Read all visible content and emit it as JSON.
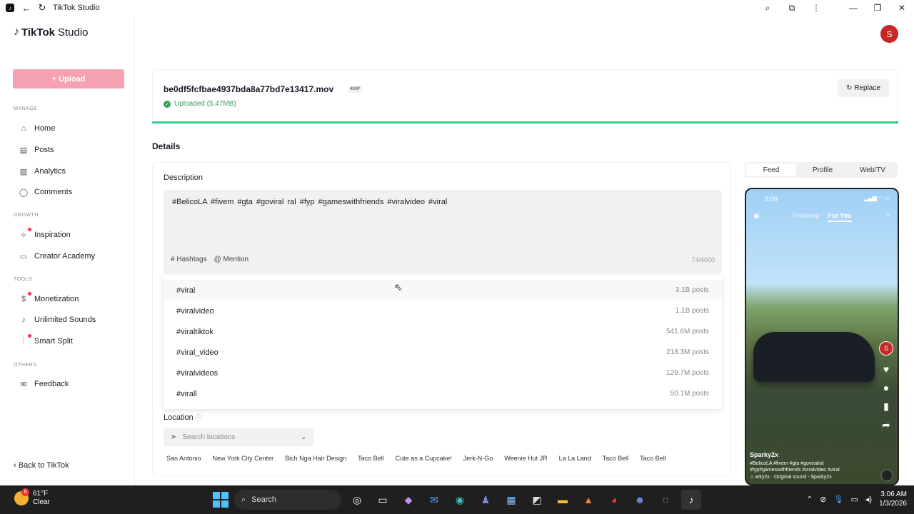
{
  "window": {
    "title": "TikTok Studio"
  },
  "brand": {
    "name": "TikTok",
    "suffix": "Studio"
  },
  "sidebar": {
    "upload_label": "+ Upload",
    "sections": [
      {
        "title": "MANAGE",
        "items": [
          {
            "label": "Home",
            "icon": "home-icon"
          },
          {
            "label": "Posts",
            "icon": "posts-icon"
          },
          {
            "label": "Analytics",
            "icon": "analytics-icon"
          },
          {
            "label": "Comments",
            "icon": "comments-icon"
          }
        ]
      },
      {
        "title": "GROWTH",
        "items": [
          {
            "label": "Inspiration",
            "icon": "bulb-icon"
          },
          {
            "label": "Creator Academy",
            "icon": "academy-icon"
          }
        ]
      },
      {
        "title": "TOOLS",
        "items": [
          {
            "label": "Monetization",
            "icon": "money-icon"
          },
          {
            "label": "Unlimited Sounds",
            "icon": "music-icon"
          },
          {
            "label": "Smart Split",
            "icon": "split-icon"
          }
        ]
      },
      {
        "title": "OTHERS",
        "items": [
          {
            "label": "Feedback",
            "icon": "feedback-icon"
          }
        ]
      }
    ],
    "back_label": "Back to TikTok"
  },
  "header": {
    "avatar_initial": "S"
  },
  "file": {
    "name": "be0df5fcfbae4937bda8a77bd7e13417.mov",
    "resolution": "480P",
    "status": "Uploaded",
    "size": "(5.47MB)",
    "replace_label": "Replace",
    "progress": 1.0
  },
  "details": {
    "title": "Details",
    "description_label": "Description",
    "description_text": "#BelicoLA  #fivem  #gta  #goviral ral  #fyp #gameswithfriends  #viralvideo  #viral",
    "hashtags_label": "Hashtags",
    "mention_label": "@ Mention",
    "char_count": "74/4000",
    "suggestions": [
      {
        "tag": "#viral",
        "count": "3.1B posts"
      },
      {
        "tag": "#viralvideo",
        "count": "1.1B posts"
      },
      {
        "tag": "#viraltiktok",
        "count": "541.6M posts"
      },
      {
        "tag": "#viral_video",
        "count": "218.3M posts"
      },
      {
        "tag": "#viralvideos",
        "count": "129.7M posts"
      },
      {
        "tag": "#virall",
        "count": "50.1M posts"
      }
    ],
    "location_label": "Location",
    "location_placeholder": "Search locations",
    "location_chips": [
      "San Antonio",
      "New York City Center",
      "Bich Nga Hair Design",
      "Taco Bell",
      "Cute as a Cupcake!",
      "Jerk-N-Go",
      "Weenie Hut JR",
      "La La Land",
      "Taco Bell",
      "Taco Bell"
    ]
  },
  "preview": {
    "tabs": [
      "Feed",
      "Profile",
      "Web/TV"
    ],
    "active_tab": "Feed",
    "time": "8:00",
    "following_label": "Following",
    "foryou_label": "For You",
    "avatar_initial": "S",
    "username": "Sparky2x",
    "caption": "#BelicoLA #fivem #gta #goviralral #fyp#gameswithfriends #viralvideo #viral",
    "sound": "♫ arky2x · Original sound - Sparky2x"
  },
  "taskbar": {
    "weather_badge": "6",
    "temp": "61°F",
    "condition": "Clear",
    "search_label": "Search",
    "time": "3:06 AM",
    "date": "1/3/2026"
  }
}
